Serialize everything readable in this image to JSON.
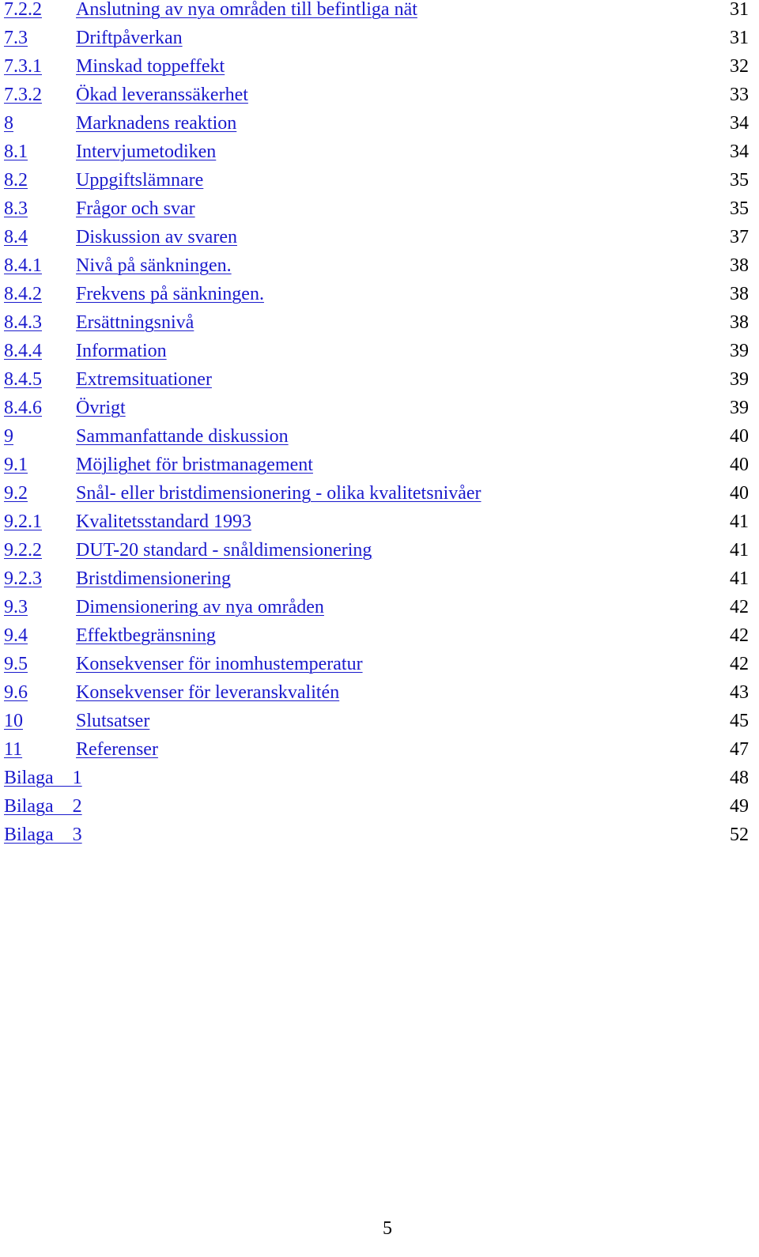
{
  "toc": {
    "entries": [
      {
        "number": "7.2.2",
        "title": "Anslutning av nya områden till befintliga nät",
        "page": "31"
      },
      {
        "number": "7.3",
        "title": "Driftpåverkan",
        "page": "31"
      },
      {
        "number": "7.3.1",
        "title": "Minskad toppeffekt",
        "page": "32"
      },
      {
        "number": "7.3.2",
        "title": "Ökad leveranssäkerhet",
        "page": "33"
      },
      {
        "number": "8",
        "title": "Marknadens reaktion",
        "page": "34"
      },
      {
        "number": "8.1",
        "title": "Intervjumetodiken",
        "page": "34"
      },
      {
        "number": "8.2",
        "title": "Uppgiftslämnare",
        "page": "35"
      },
      {
        "number": "8.3",
        "title": "Frågor och svar",
        "page": "35"
      },
      {
        "number": "8.4",
        "title": "Diskussion av svaren",
        "page": "37"
      },
      {
        "number": "8.4.1",
        "title": "Nivå på sänkningen.",
        "page": "38"
      },
      {
        "number": "8.4.2",
        "title": "Frekvens på sänkningen.",
        "page": "38"
      },
      {
        "number": "8.4.3",
        "title": "Ersättningsnivå",
        "page": "38"
      },
      {
        "number": "8.4.4",
        "title": "Information",
        "page": "39"
      },
      {
        "number": "8.4.5",
        "title": "Extremsituationer",
        "page": "39"
      },
      {
        "number": "8.4.6",
        "title": "Övrigt",
        "page": "39"
      },
      {
        "number": "9",
        "title": "Sammanfattande diskussion",
        "page": "40"
      },
      {
        "number": "9.1",
        "title": "Möjlighet för bristmanagement",
        "page": "40"
      },
      {
        "number": "9.2",
        "title": "Snål- eller bristdimensionering - olika kvalitetsnivåer",
        "page": "40"
      },
      {
        "number": "9.2.1",
        "title": "Kvalitetsstandard 1993",
        "page": "41"
      },
      {
        "number": "9.2.2",
        "title": "DUT-20 standard - snåldimensionering",
        "page": "41"
      },
      {
        "number": "9.2.3",
        "title": "Bristdimensionering",
        "page": "41"
      },
      {
        "number": "9.3",
        "title": "Dimensionering av nya områden",
        "page": "42"
      },
      {
        "number": "9.4",
        "title": "Effektbegränsning",
        "page": "42"
      },
      {
        "number": "9.5",
        "title": "Konsekvenser för inomhustemperatur",
        "page": "42"
      },
      {
        "number": "9.6",
        "title": "Konsekvenser för leveranskvalitén",
        "page": "43"
      },
      {
        "number": "10",
        "title": "Slutsatser",
        "page": "45"
      },
      {
        "number": "11",
        "title": "Referenser",
        "page": "47"
      }
    ],
    "appendices": [
      {
        "label": "Bilaga    1",
        "page": "48"
      },
      {
        "label": "Bilaga    2",
        "page": "49"
      },
      {
        "label": "Bilaga    3",
        "page": "52"
      }
    ]
  },
  "footer": {
    "page_number": "5"
  },
  "colors": {
    "link": "#1a1acc",
    "text": "#000000",
    "background": "#ffffff"
  }
}
